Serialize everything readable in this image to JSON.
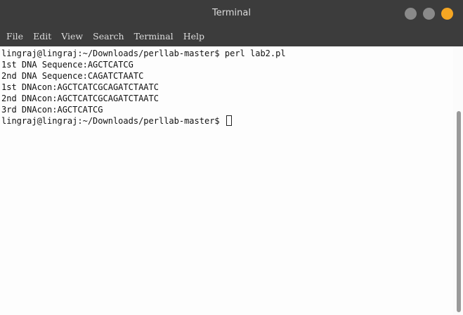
{
  "window": {
    "title": "Terminal"
  },
  "menu": {
    "items": [
      "File",
      "Edit",
      "View",
      "Search",
      "Terminal",
      "Help"
    ]
  },
  "terminal": {
    "lines": [
      "lingraj@lingraj:~/Downloads/perllab-master$ perl lab2.pl",
      "1st DNA Sequence:AGCTCATCG",
      "2nd DNA Sequence:CAGATCTAATC",
      "1st DNAcon:AGCTCATCGCAGATCTAATC",
      "2nd DNAcon:AGCTCATCGCAGATCTAATC",
      "3rd DNAcon:AGCTCATCG"
    ],
    "prompt": "lingraj@lingraj:~/Downloads/perllab-master$ "
  },
  "colors": {
    "titlebar": "#3c3c3c",
    "close_button": "#f5a623",
    "window_button": "#8a8a8a",
    "terminal_bg": "#fdfdfd"
  }
}
